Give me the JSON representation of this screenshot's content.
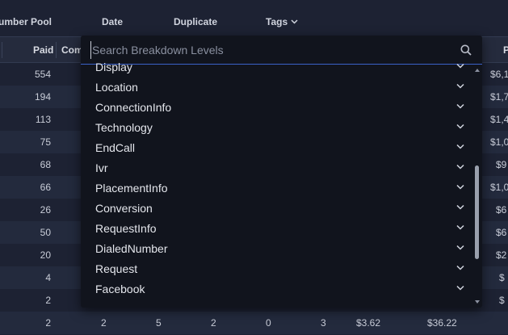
{
  "tabs": {
    "number_pool": "umber Pool",
    "date": "Date",
    "duplicate": "Duplicate",
    "tags": "Tags"
  },
  "table": {
    "headers": {
      "paid": "Paid",
      "com": "Com",
      "p": "P"
    },
    "rows": [
      {
        "paid": "554",
        "right": "$6,1"
      },
      {
        "paid": "194",
        "right": "$1,7"
      },
      {
        "paid": "113",
        "right": "$1,4"
      },
      {
        "paid": "75",
        "right": "$1,0"
      },
      {
        "paid": "68",
        "right": "$9"
      },
      {
        "paid": "66",
        "right": "$1,0"
      },
      {
        "paid": "26",
        "right": "$6"
      },
      {
        "paid": "50",
        "right": "$6"
      },
      {
        "paid": "20",
        "right": "$2"
      },
      {
        "paid": "4",
        "right": "$"
      },
      {
        "paid": "2",
        "right": "$"
      }
    ],
    "last_row": [
      "2",
      "2",
      "5",
      "2",
      "0",
      "3",
      "$3.62",
      "$36.22"
    ]
  },
  "dropdown": {
    "search_placeholder": "Search Breakdown Levels",
    "items": [
      "Display",
      "Location",
      "ConnectionInfo",
      "Technology",
      "EndCall",
      "Ivr",
      "PlacementInfo",
      "Conversion",
      "RequestInfo",
      "DialedNumber",
      "Request",
      "Facebook"
    ]
  }
}
